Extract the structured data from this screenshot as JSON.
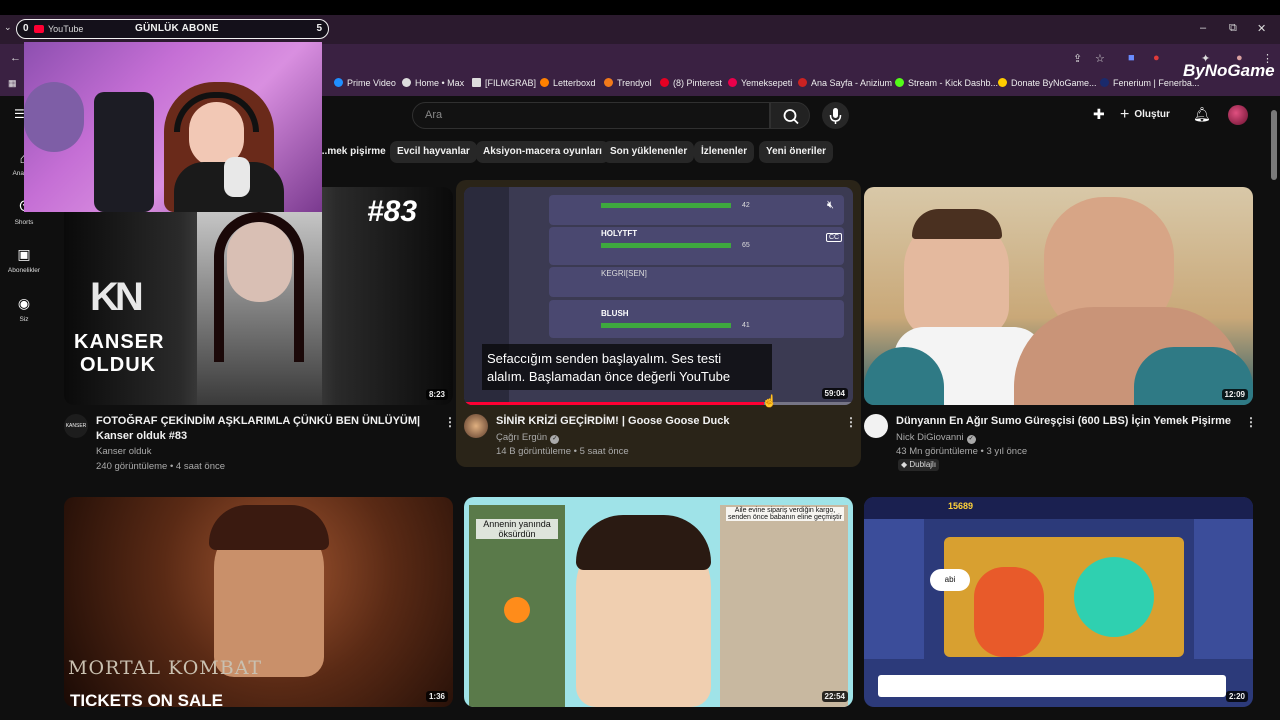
{
  "tabbar": {
    "left_num": "0",
    "site": "YouTube",
    "title": "GÜNLÜK ABONE",
    "right_num": "5"
  },
  "bookmarks": [
    {
      "label": "Prime Video",
      "color": "#1f8fff"
    },
    {
      "label": "Home • Max",
      "color": "#dddddd"
    },
    {
      "label": "[FILMGRAB]",
      "color": "#dddddd"
    },
    {
      "label": "Letterboxd",
      "color": "#ff8000"
    },
    {
      "label": "Trendyol",
      "color": "#f27a1a"
    },
    {
      "label": "(8) Pinterest",
      "color": "#e60023"
    },
    {
      "label": "Yemeksepeti",
      "color": "#ea004b"
    },
    {
      "label": "Ana Sayfa - Anizium",
      "color": "#cc2222"
    },
    {
      "label": "Stream - Kick Dashb...",
      "color": "#53fc18"
    },
    {
      "label": "Donate ByNoGame...",
      "color": "#ffcc00"
    },
    {
      "label": "Fenerium | Fenerba...",
      "color": "#1a2a6c"
    }
  ],
  "brand_overlay": "ByNoGame",
  "search": {
    "placeholder": "Ara"
  },
  "header": {
    "create_label": "Oluştur"
  },
  "chips": [
    "...mek pişirme",
    "Evcil hayvanlar",
    "Aksiyon-macera oyunları",
    "Son yüklenenler",
    "İzlenenler",
    "Yeni öneriler"
  ],
  "sidebar": [
    {
      "label": "Ana S...",
      "icon": "home-icon"
    },
    {
      "label": "Shorts",
      "icon": "shorts-icon"
    },
    {
      "label": "Abonelikler",
      "icon": "subscriptions-icon"
    },
    {
      "label": "Siz",
      "icon": "you-icon"
    }
  ],
  "videos": [
    {
      "title": "FOTOĞRAF ÇEKİNDİM AŞKLARIMLA ÇÜNKÜ BEN ÜNLÜYÜM| Kanser olduk #83",
      "channel": "Kanser olduk",
      "meta": "240 görüntüleme • 4 saat önce",
      "duration": "8:23",
      "thumb_text_1": "KANSER",
      "thumb_text_2": "OLDUK",
      "thumb_badge": "#83",
      "thumb_logo": "KN"
    },
    {
      "title": "SİNİR KRİZİ GEÇİRDİM! | Goose Goose Duck",
      "channel": "Çağrı Ergün",
      "meta": "14 B görüntüleme • 5 saat önce",
      "duration": "59:04",
      "caption_line1": "Sefaccığım senden başlayalım. Ses testi",
      "caption_line2": "alalım. Başlamadan önce değerli YouTube",
      "players": [
        "HOLYTFT",
        "KEGRI[SEN]",
        "BLUSH"
      ],
      "scores": [
        "42",
        "65",
        "41"
      ],
      "progress": 0.77,
      "cc_label": "CC"
    },
    {
      "title": "Dünyanın En Ağır Sumo Güreşçisi (600 LBS) İçin Yemek Pişirme",
      "channel": "Nick DiGiovanni",
      "meta": "43 Mn görüntüleme • 3 yıl önce",
      "duration": "12:09",
      "badge": "Dublajlı"
    },
    {
      "duration": "1:36",
      "thumb_text_1": "MORTAL KOMBAT",
      "thumb_text_2": "TICKETS ON SALE"
    },
    {
      "duration": "22:54",
      "thumb_text_1": "Annenin yanında öksürdün",
      "thumb_text_2": "Aile evine sipariş verdiğin kargo, senden önce babanın eline geçmiştir"
    },
    {
      "duration": "2:20",
      "thumb_text_1": "abi",
      "thumb_text_2": "15689"
    }
  ]
}
